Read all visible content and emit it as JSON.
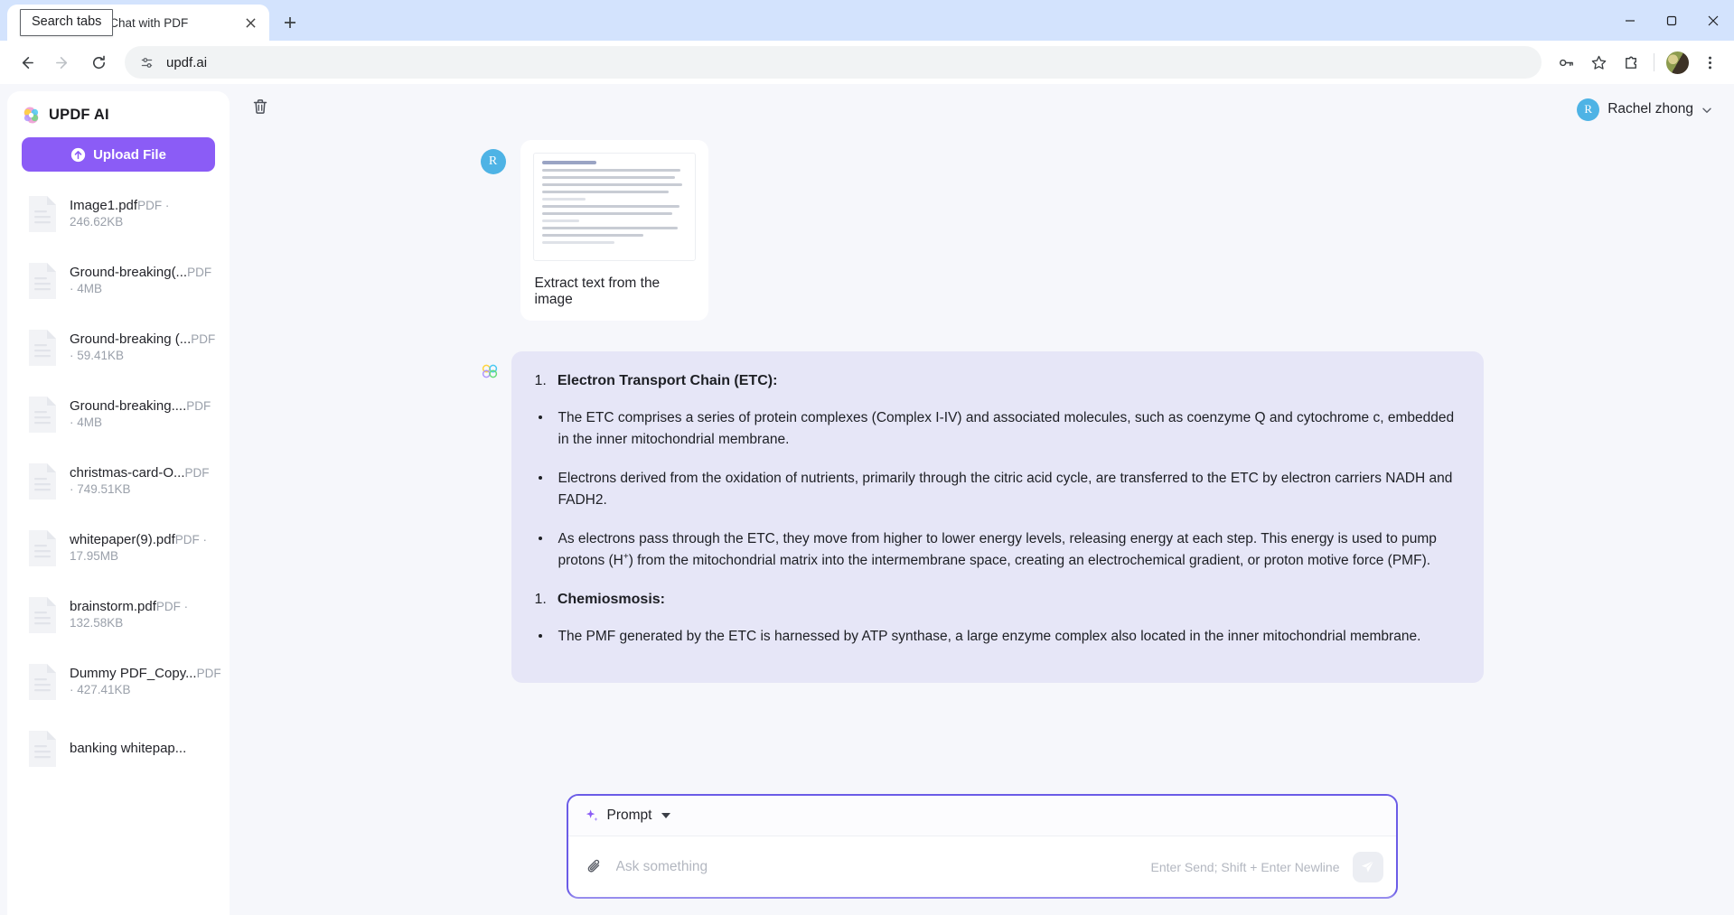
{
  "browser": {
    "tab": {
      "title": "F AI Online: Chat with PDF",
      "favicon_icon": "updf-favicon-icon",
      "close_icon": "close-icon"
    },
    "tooltip": "Search tabs",
    "new_tab_icon": "plus-icon",
    "window_controls": {
      "minimize_icon": "minimize-icon",
      "maximize_icon": "maximize-icon",
      "close_icon": "window-close-icon"
    },
    "nav": {
      "back_icon": "back-arrow-icon",
      "forward_icon": "forward-arrow-icon",
      "reload_icon": "reload-icon"
    },
    "omnibox": {
      "site_settings_icon": "tune-icon",
      "url": "updf.ai"
    },
    "toolbar_icons": {
      "passwords": "key-icon",
      "bookmark": "star-icon",
      "extensions": "extensions-puzzle-icon",
      "profile": "profile-avatar",
      "menu": "three-dot-menu-icon"
    }
  },
  "sidebar": {
    "brand": "UPDF AI",
    "brand_icon": "updf-logo-icon",
    "upload_button": "Upload File",
    "upload_icon": "upload-arrow-icon",
    "files": [
      {
        "name": "Image1.pdf",
        "meta": "PDF · 246.62KB"
      },
      {
        "name": "Ground-breaking(...",
        "meta": "PDF · 4MB"
      },
      {
        "name": "Ground-breaking (...",
        "meta": "PDF · 59.41KB"
      },
      {
        "name": "Ground-breaking....",
        "meta": "PDF · 4MB"
      },
      {
        "name": "christmas-card-O...",
        "meta": "PDF · 749.51KB"
      },
      {
        "name": "whitepaper(9).pdf",
        "meta": "PDF · 17.95MB"
      },
      {
        "name": "brainstorm.pdf",
        "meta": "PDF · 132.58KB"
      },
      {
        "name": "Dummy PDF_Copy...",
        "meta": "PDF · 427.41KB"
      },
      {
        "name": "banking whitepap...",
        "meta": ""
      }
    ]
  },
  "main": {
    "delete_icon": "trash-icon",
    "user": {
      "initial": "R",
      "name": "Rachel zhong",
      "caret_icon": "chevron-down-icon"
    },
    "user_message": {
      "avatar_initial": "R",
      "attachment_icon": "document-thumbnail",
      "caption": "Extract text from the image"
    },
    "ai_message": {
      "avatar_icon": "updf-ai-logo-icon",
      "blocks": [
        {
          "type": "ordered",
          "num": "1.",
          "text": "Electron Transport Chain (ETC):"
        },
        {
          "type": "bullet",
          "text": "The ETC comprises a series of protein complexes (Complex I-IV) and associated molecules, such as coenzyme Q and cytochrome c, embedded in the inner mitochondrial membrane."
        },
        {
          "type": "bullet",
          "text": "Electrons derived from the oxidation of nutrients, primarily through the citric acid cycle, are transferred to the ETC by electron carriers NADH and FADH2."
        },
        {
          "type": "bullet",
          "text": "As electrons pass through the ETC, they move from higher to lower energy levels, releasing energy at each step. This energy is used to pump protons (H+) from the mitochondrial matrix into the intermembrane space, creating an electrochemical gradient, or proton motive force (PMF)."
        },
        {
          "type": "ordered",
          "num": "1.",
          "text": "Chemiosmosis:"
        },
        {
          "type": "bullet",
          "text": "The PMF generated by the ETC is harnessed by ATP synthase, a large enzyme complex also located in the inner mitochondrial membrane."
        }
      ]
    },
    "composer": {
      "prompt_label": "Prompt",
      "prompt_icon": "sparkle-icon",
      "dropdown_icon": "caret-down-icon",
      "attach_icon": "paperclip-icon",
      "input_value": "",
      "input_placeholder": "Ask something",
      "hint": "Enter Send; Shift + Enter Newline",
      "send_icon": "send-paper-plane-icon"
    }
  },
  "colors": {
    "accent_purple": "#8b5cf6",
    "composer_border": "#6b5ce7",
    "ai_bubble": "#e6e6f7",
    "avatar_blue": "#4eb3e5",
    "page_bg": "#f6f7fb",
    "chrome_bg": "#d3e3fd"
  }
}
